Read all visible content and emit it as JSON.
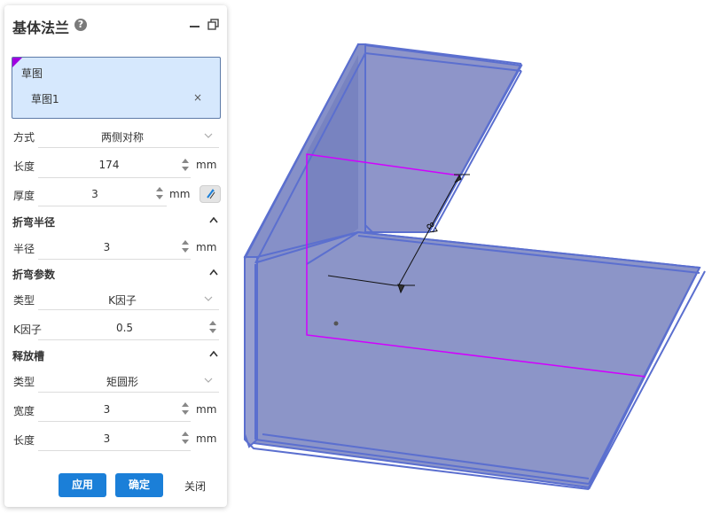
{
  "panel": {
    "title": "基体法兰",
    "help_glyph": "?",
    "sketch": {
      "title": "草图",
      "item": "草图1",
      "remove": "×"
    },
    "fields": {
      "method": {
        "label": "方式",
        "value": "两侧对称"
      },
      "length": {
        "label": "长度",
        "value": "174",
        "unit": "mm"
      },
      "thickness": {
        "label": "厚度",
        "value": "3",
        "unit": "mm"
      }
    },
    "bend_radius": {
      "title": "折弯半径",
      "radius": {
        "label": "半径",
        "value": "3",
        "unit": "mm"
      }
    },
    "bend_params": {
      "title": "折弯参数",
      "type": {
        "label": "类型",
        "value": "K因子"
      },
      "kfactor": {
        "label": "K因子",
        "value": "0.5"
      }
    },
    "relief": {
      "title": "释放槽",
      "type": {
        "label": "类型",
        "value": "矩圆形"
      },
      "width": {
        "label": "宽度",
        "value": "3",
        "unit": "mm"
      },
      "length": {
        "label": "长度",
        "value": "3",
        "unit": "mm"
      }
    },
    "buttons": {
      "apply": "应用",
      "ok": "确定",
      "close": "关闭"
    }
  },
  "viewport": {
    "dimension_label": "87",
    "colors": {
      "part_fill": "#8d96c9",
      "part_edge": "#5b6fcf",
      "sketch_line": "#d100ff",
      "panel_accent": "#1b7fd8"
    }
  }
}
